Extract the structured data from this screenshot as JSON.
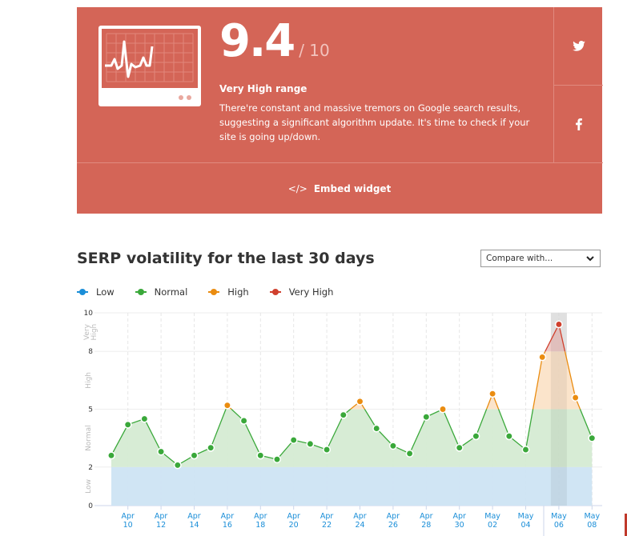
{
  "card": {
    "score": "9.4",
    "score_max": "/ 10",
    "range_label": "Very High range",
    "description": "There're constant and massive tremors on Google search results, suggesting a significant algorithm update. It's time to check if your site is going up/down.",
    "embed_label": "Embed widget",
    "embed_icon": "code-icon",
    "social": [
      {
        "name": "twitter-icon"
      },
      {
        "name": "facebook-icon"
      }
    ],
    "color": "#d46557"
  },
  "section_title": "SERP volatility for the last 30 days",
  "compare_select": {
    "value": "Compare with..."
  },
  "legend": [
    {
      "label": "Low",
      "color": "#1a8ed8"
    },
    {
      "label": "Normal",
      "color": "#3aa83a"
    },
    {
      "label": "High",
      "color": "#ea8c10"
    },
    {
      "label": "Very High",
      "color": "#d0402e"
    }
  ],
  "chart_data": {
    "type": "area",
    "title": "SERP volatility for the last 30 days",
    "xlabel": "",
    "ylabel": "",
    "ylim": [
      0,
      10
    ],
    "yticks": [
      0,
      2,
      5,
      8,
      10
    ],
    "bands": [
      {
        "label": "Low",
        "from": 0,
        "to": 2
      },
      {
        "label": "Normal",
        "from": 2,
        "to": 5
      },
      {
        "label": "High",
        "from": 5,
        "to": 8
      },
      {
        "label": "Very High",
        "from": 8,
        "to": 10
      }
    ],
    "x": [
      "Apr 09",
      "Apr 10",
      "Apr 11",
      "Apr 12",
      "Apr 13",
      "Apr 14",
      "Apr 15",
      "Apr 16",
      "Apr 17",
      "Apr 18",
      "Apr 19",
      "Apr 20",
      "Apr 21",
      "Apr 22",
      "Apr 23",
      "Apr 24",
      "Apr 25",
      "Apr 26",
      "Apr 27",
      "Apr 28",
      "Apr 29",
      "Apr 30",
      "May 01",
      "May 02",
      "May 03",
      "May 04",
      "May 05",
      "May 06",
      "May 07",
      "May 08"
    ],
    "values": [
      2.6,
      4.2,
      4.5,
      2.8,
      2.1,
      2.6,
      3.0,
      5.2,
      4.4,
      2.6,
      2.4,
      3.4,
      3.2,
      2.9,
      4.7,
      5.4,
      4.0,
      3.1,
      2.7,
      4.6,
      5.0,
      3.0,
      3.6,
      5.8,
      3.6,
      2.9,
      7.7,
      9.4,
      5.6,
      3.5
    ],
    "xtick_labels": [
      {
        "m": "Apr",
        "d": "10"
      },
      {
        "m": "Apr",
        "d": "12"
      },
      {
        "m": "Apr",
        "d": "14"
      },
      {
        "m": "Apr",
        "d": "16"
      },
      {
        "m": "Apr",
        "d": "18"
      },
      {
        "m": "Apr",
        "d": "20"
      },
      {
        "m": "Apr",
        "d": "22"
      },
      {
        "m": "Apr",
        "d": "24"
      },
      {
        "m": "Apr",
        "d": "26"
      },
      {
        "m": "Apr",
        "d": "28"
      },
      {
        "m": "Apr",
        "d": "30"
      },
      {
        "m": "May",
        "d": "02"
      },
      {
        "m": "May",
        "d": "04"
      },
      {
        "m": "May",
        "d": "06"
      },
      {
        "m": "May",
        "d": "08"
      }
    ],
    "highlighted": "May 06",
    "grid": true,
    "legend_position": "top-left"
  }
}
